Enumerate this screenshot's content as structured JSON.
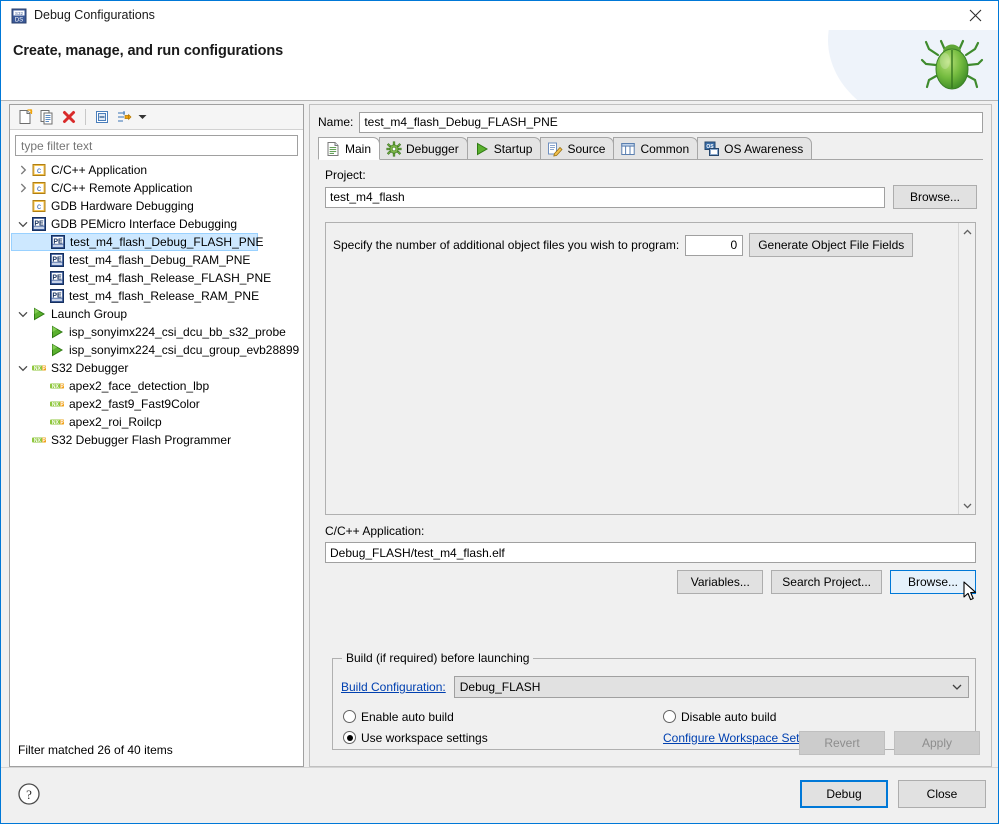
{
  "window": {
    "title": "Debug Configurations",
    "title_icon": "s32ds-icon",
    "close_label": "close-icon",
    "banner_title": "Create, manage, and run configurations",
    "banner_icon": "bug-icon",
    "accent_color": "#0078d7",
    "selection_color": "#cde8ff"
  },
  "left": {
    "toolbar": [
      {
        "name": "new-configuration-button",
        "icon": "new-document-icon"
      },
      {
        "name": "duplicate-configuration-button",
        "icon": "copy-icon"
      },
      {
        "name": "delete-configuration-button",
        "icon": "red-x-delete-icon"
      },
      {
        "name": "collapse-all-button",
        "icon": "collapse-all-icon"
      },
      {
        "name": "filter-configurations-button",
        "icon": "filter-sort-icon"
      },
      {
        "name": "toolbar-menu-button",
        "icon": "chevron-down-icon"
      }
    ],
    "filter": {
      "value": "",
      "placeholder": "type filter text"
    },
    "tree": [
      {
        "label": "C/C++ Application",
        "icon": "c-app-icon",
        "indent": 0,
        "twisty": "collapsed",
        "selected": false
      },
      {
        "label": "C/C++ Remote Application",
        "icon": "c-app-icon",
        "indent": 0,
        "twisty": "collapsed",
        "selected": false
      },
      {
        "label": "GDB Hardware Debugging",
        "icon": "c-app-icon",
        "indent": 0,
        "twisty": "none",
        "selected": false
      },
      {
        "label": "GDB PEMicro Interface Debugging",
        "icon": "pemicro-icon",
        "indent": 0,
        "twisty": "expanded",
        "selected": false
      },
      {
        "label": "test_m4_flash_Debug_FLASH_PNE",
        "icon": "pemicro-icon",
        "indent": 1,
        "twisty": "none",
        "selected": true
      },
      {
        "label": "test_m4_flash_Debug_RAM_PNE",
        "icon": "pemicro-icon",
        "indent": 1,
        "twisty": "none",
        "selected": false
      },
      {
        "label": "test_m4_flash_Release_FLASH_PNE",
        "icon": "pemicro-icon",
        "indent": 1,
        "twisty": "none",
        "selected": false
      },
      {
        "label": "test_m4_flash_Release_RAM_PNE",
        "icon": "pemicro-icon",
        "indent": 1,
        "twisty": "none",
        "selected": false
      },
      {
        "label": "Launch Group",
        "icon": "launch-group-icon",
        "indent": 0,
        "twisty": "expanded",
        "selected": false
      },
      {
        "label": "isp_sonyimx224_csi_dcu_bb_s32_probe",
        "icon": "launch-group-icon",
        "indent": 1,
        "twisty": "none",
        "selected": false
      },
      {
        "label": "isp_sonyimx224_csi_dcu_group_evb28899",
        "icon": "launch-group-icon",
        "indent": 1,
        "twisty": "none",
        "selected": false
      },
      {
        "label": "S32 Debugger",
        "icon": "nxp-icon",
        "indent": 0,
        "twisty": "expanded",
        "selected": false
      },
      {
        "label": "apex2_face_detection_lbp",
        "icon": "nxp-icon",
        "indent": 1,
        "twisty": "none",
        "selected": false
      },
      {
        "label": "apex2_fast9_Fast9Color",
        "icon": "nxp-icon",
        "indent": 1,
        "twisty": "none",
        "selected": false
      },
      {
        "label": "apex2_roi_Roilcp",
        "icon": "nxp-icon",
        "indent": 1,
        "twisty": "none",
        "selected": false
      },
      {
        "label": "S32 Debugger Flash Programmer",
        "icon": "nxp-icon",
        "indent": 0,
        "twisty": "none",
        "selected": false
      }
    ],
    "filter_status": "Filter matched 26 of 40 items"
  },
  "right": {
    "name_label": "Name:",
    "name_value": "test_m4_flash_Debug_FLASH_PNE",
    "tabs": [
      {
        "label": "Main",
        "icon": "main-page-icon",
        "active": true
      },
      {
        "label": "Debugger",
        "icon": "debugger-gear-icon",
        "active": false
      },
      {
        "label": "Startup",
        "icon": "startup-play-icon",
        "active": false
      },
      {
        "label": "Source",
        "icon": "source-pencil-icon",
        "active": false
      },
      {
        "label": "Common",
        "icon": "common-window-icon",
        "active": false
      },
      {
        "label": "OS Awareness",
        "icon": "os-awareness-icon",
        "active": false
      }
    ],
    "main": {
      "project_label": "Project:",
      "project_value": "test_m4_flash",
      "project_browse_label": "Browse...",
      "object_files_label": "Specify the number of additional object files you wish to program:",
      "object_files_count": "0",
      "generate_object_fields_label": "Generate Object File Fields",
      "app_label": "C/C++ Application:",
      "app_value": "Debug_FLASH/test_m4_flash.elf",
      "variables_label": "Variables...",
      "search_project_label": "Search Project...",
      "app_browse_label": "Browse...",
      "build_group_title": "Build (if required) before launching",
      "build_configuration_link": "Build Configuration:",
      "build_configuration_value": "Debug_FLASH",
      "enable_auto_build_label": "Enable auto build",
      "disable_auto_build_label": "Disable auto build",
      "use_workspace_settings_label": "Use workspace settings",
      "configure_workspace_link": "Configure Workspace Settings...",
      "selected_build_radio": "use_workspace_settings"
    },
    "revert_label": "Revert",
    "apply_label": "Apply"
  },
  "footer": {
    "help_icon": "help-question-icon",
    "debug_label": "Debug",
    "close_label": "Close"
  }
}
